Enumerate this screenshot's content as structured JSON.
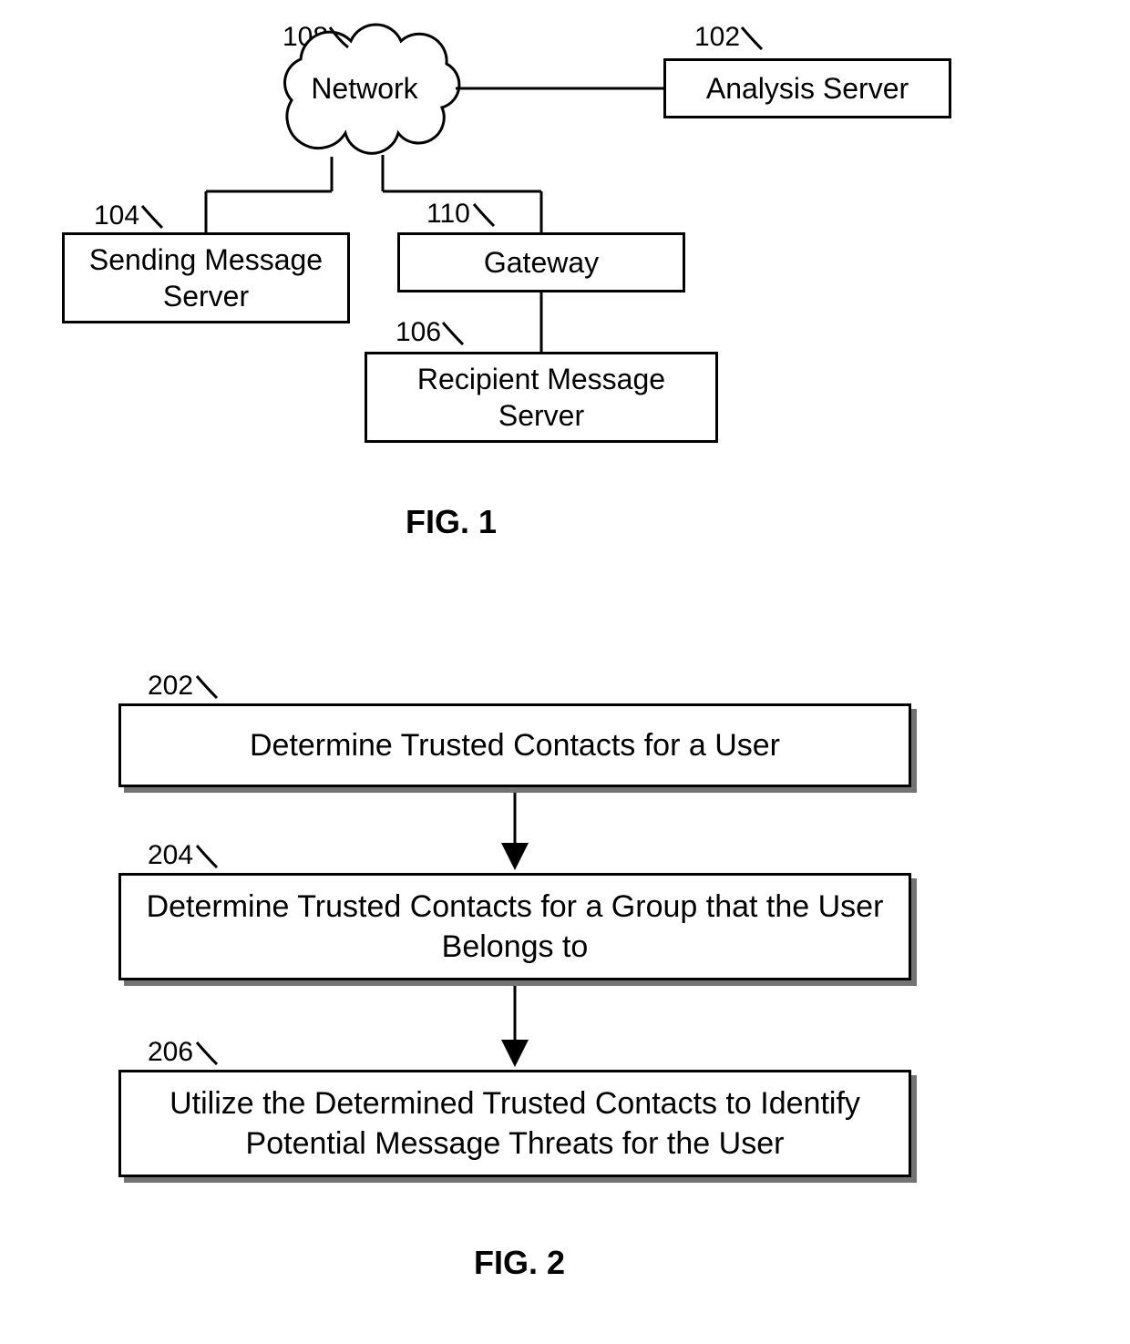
{
  "fig1": {
    "caption": "FIG. 1",
    "nodes": {
      "network": {
        "ref": "108",
        "label": "Network"
      },
      "analysis_server": {
        "ref": "102",
        "label": "Analysis Server"
      },
      "sending_server": {
        "ref": "104",
        "label": "Sending Message Server"
      },
      "gateway": {
        "ref": "110",
        "label": "Gateway"
      },
      "recipient_server": {
        "ref": "106",
        "label": "Recipient Message Server"
      }
    }
  },
  "fig2": {
    "caption": "FIG. 2",
    "steps": [
      {
        "ref": "202",
        "text": "Determine Trusted Contacts for a User"
      },
      {
        "ref": "204",
        "text": "Determine Trusted Contacts for a Group that the User Belongs to"
      },
      {
        "ref": "206",
        "text": "Utilize the Determined Trusted Contacts to Identify Potential Message Threats for the User"
      }
    ]
  }
}
